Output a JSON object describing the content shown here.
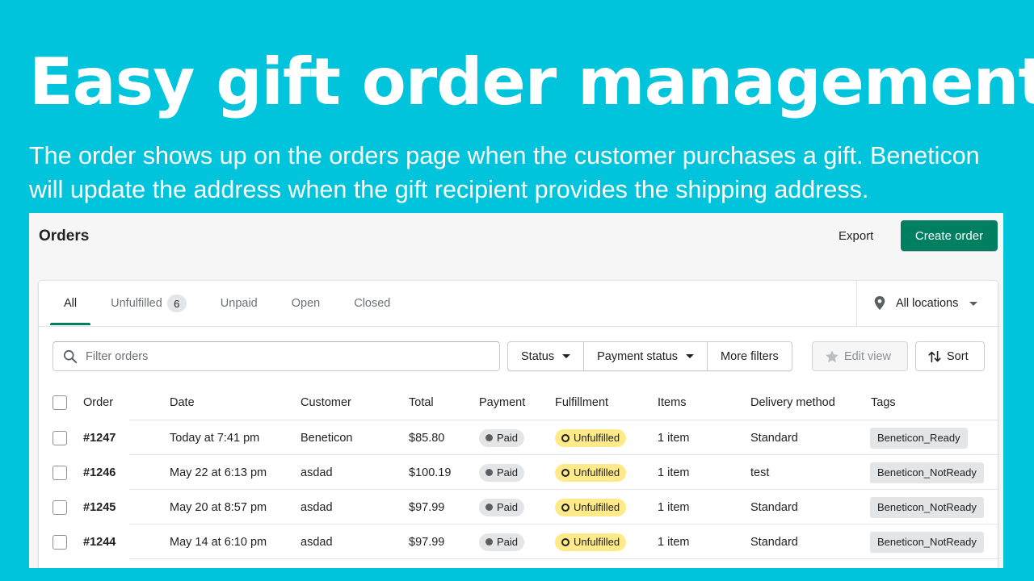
{
  "hero": {
    "title": "Easy gift order management",
    "subtitle": "The order shows up on the orders page when the customer purchases a gift. Beneticon will update the address when the gift recipient provides the shipping address."
  },
  "page": {
    "title": "Orders",
    "export_label": "Export",
    "create_label": "Create order"
  },
  "tabs": [
    {
      "label": "All"
    },
    {
      "label": "Unfulfilled",
      "count": "6"
    },
    {
      "label": "Unpaid"
    },
    {
      "label": "Open"
    },
    {
      "label": "Closed"
    }
  ],
  "location": {
    "label": "All locations"
  },
  "search": {
    "placeholder": "Filter orders"
  },
  "filters": {
    "status": "Status",
    "payment_status": "Payment status",
    "more": "More filters",
    "edit_view": "Edit view",
    "sort": "Sort"
  },
  "table": {
    "columns": [
      "Order",
      "Date",
      "Customer",
      "Total",
      "Payment",
      "Fulfillment",
      "Items",
      "Delivery method",
      "Tags"
    ],
    "rows": [
      {
        "order": "#1247",
        "date": "Today at 7:41 pm",
        "customer": "Beneticon",
        "total": "$85.80",
        "payment": "Paid",
        "fulfillment": "Unfulfilled",
        "items": "1 item",
        "delivery": "Standard",
        "tag": "Beneticon_Ready"
      },
      {
        "order": "#1246",
        "date": "May 22 at 6:13 pm",
        "customer": "asdad",
        "total": "$100.19",
        "payment": "Paid",
        "fulfillment": "Unfulfilled",
        "items": "1 item",
        "delivery": "test",
        "tag": "Beneticon_NotReady"
      },
      {
        "order": "#1245",
        "date": "May 20 at 8:57 pm",
        "customer": "asdad",
        "total": "$97.99",
        "payment": "Paid",
        "fulfillment": "Unfulfilled",
        "items": "1 item",
        "delivery": "Standard",
        "tag": "Beneticon_NotReady"
      },
      {
        "order": "#1244",
        "date": "May 14 at 6:10 pm",
        "customer": "asdad",
        "total": "$97.99",
        "payment": "Paid",
        "fulfillment": "Unfulfilled",
        "items": "1 item",
        "delivery": "Standard",
        "tag": "Beneticon_NotReady"
      }
    ]
  },
  "colors": {
    "background": "#00c4db",
    "primary": "#008060",
    "unfulfilled_badge": "#ffea8a",
    "paid_badge": "#e4e5e7"
  },
  "icons": [
    "search-icon",
    "location-pin-icon",
    "star-icon",
    "sort-arrows-icon",
    "chevron-down-icon"
  ]
}
